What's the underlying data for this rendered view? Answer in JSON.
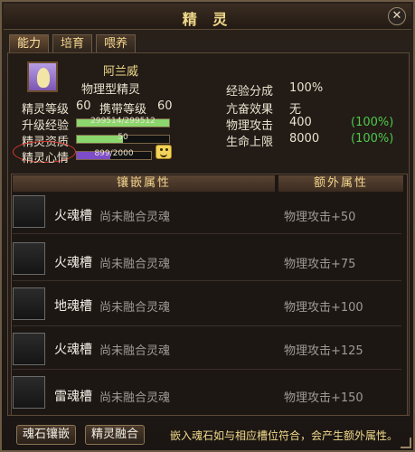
{
  "window": {
    "title": "精 灵",
    "close_glyph": "✕"
  },
  "tabs": [
    {
      "label": "能力",
      "active": true
    },
    {
      "label": "培育",
      "active": false
    },
    {
      "label": "喂养",
      "active": false
    }
  ],
  "spirit": {
    "name": "阿兰威",
    "type": "物理型精灵",
    "left_stats": {
      "level_label": "精灵等级",
      "level_value": "60",
      "carry_label": "携带等级",
      "carry_value": "60",
      "exp_label": "升级经验",
      "exp_text": "299514/299512",
      "exp_fraction": 1.0,
      "quality_label": "精灵资质",
      "quality_text": "50",
      "quality_fraction": 0.5,
      "mood_label": "精灵心情",
      "mood_text": "899/2000",
      "mood_fraction": 0.45
    },
    "right_stats": {
      "exp_share_label": "经验分成",
      "exp_share_value": "100%",
      "resonance_label": "亢奋效果",
      "resonance_value": "无",
      "phys_attack_label": "物理攻击",
      "phys_attack_value": "400",
      "phys_attack_pct": "(100%)",
      "hp_label": "生命上限",
      "hp_value": "8000",
      "hp_pct": "(100%)"
    }
  },
  "inlay": {
    "header_inlay": "镶嵌属性",
    "header_extra": "额外属性",
    "rows": [
      {
        "slot": "火魂槽",
        "state": "尚未融合灵魂",
        "bonus": "物理攻击+50"
      },
      {
        "slot": "火魂槽",
        "state": "尚未融合灵魂",
        "bonus": "物理攻击+75"
      },
      {
        "slot": "地魂槽",
        "state": "尚未融合灵魂",
        "bonus": "物理攻击+100"
      },
      {
        "slot": "火魂槽",
        "state": "尚未融合灵魂",
        "bonus": "物理攻击+125"
      },
      {
        "slot": "雷魂槽",
        "state": "尚未融合灵魂",
        "bonus": "物理攻击+150"
      }
    ]
  },
  "footer": {
    "btn_inlay": "魂石镶嵌",
    "btn_fuse": "精灵融合",
    "hint": "嵌入魂石如与相应槽位符合，会产生额外属性。"
  },
  "colors": {
    "accent_gold": "#f0d98a",
    "positive_green": "#4ec94a",
    "exp_bar": "#8bd66d",
    "quality_bar": "#8bd66d",
    "mood_bar": "#7d4cc9",
    "highlight_ring": "#d4382e"
  }
}
